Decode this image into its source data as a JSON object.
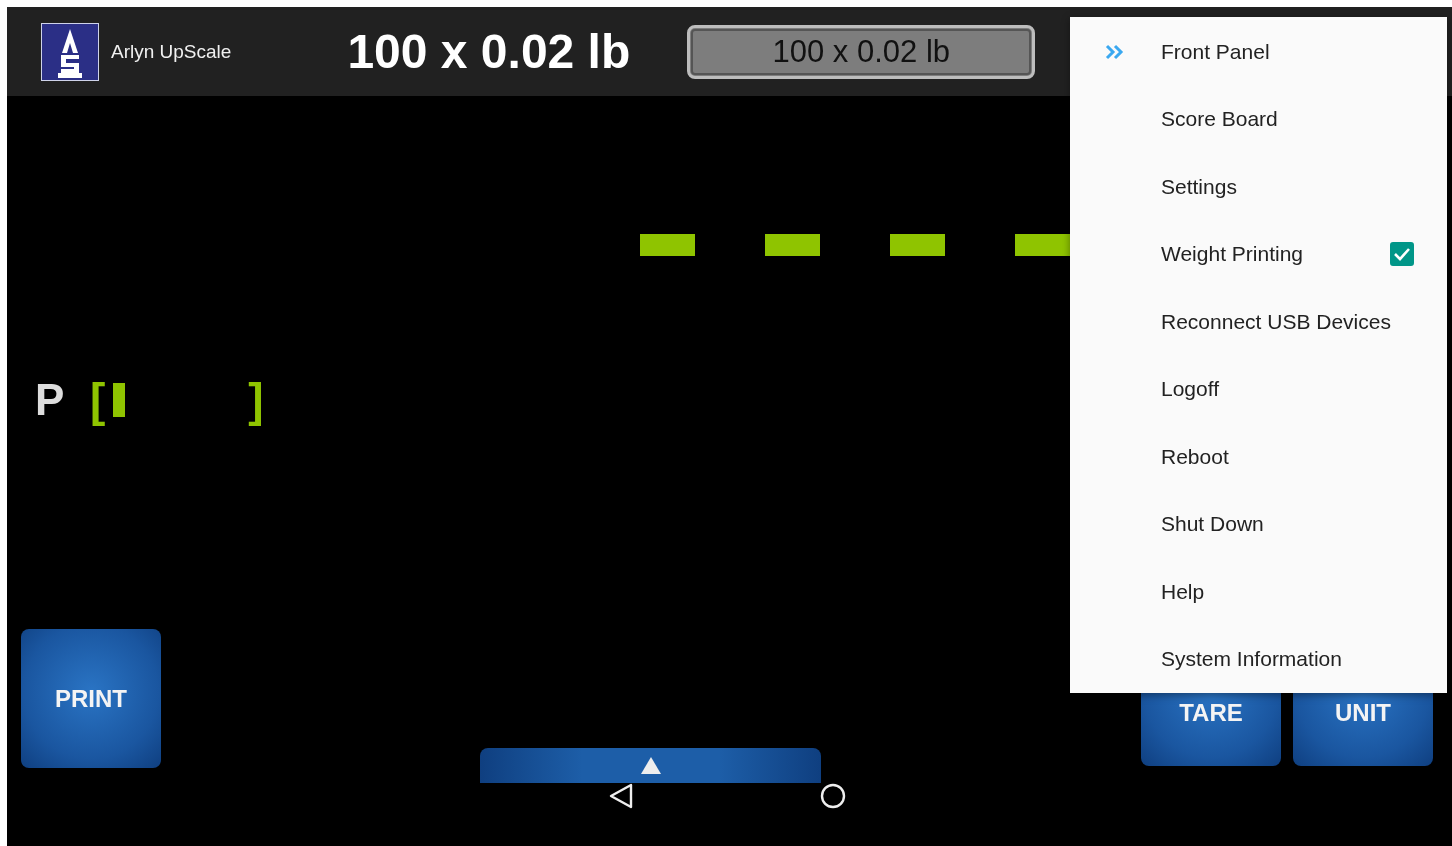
{
  "header": {
    "app_name": "Arlyn UpScale",
    "title": "100 x 0.02 lb",
    "field": {
      "value": "100 x 0.02 lb"
    }
  },
  "capacity": {
    "label": "P",
    "open_bracket": "[",
    "close_bracket": "]",
    "level": 0.09
  },
  "buttons": [
    {
      "label": "PRINT"
    },
    {
      "label": "TARE"
    },
    {
      "label": "UNIT"
    }
  ],
  "menu": {
    "items": [
      {
        "label": "Front Panel",
        "kind": "item",
        "selected": true
      },
      {
        "label": "Score Board",
        "kind": "item",
        "selected": false
      },
      {
        "label": "Settings",
        "kind": "item",
        "selected": false
      },
      {
        "label": "Weight Printing",
        "kind": "checkbox",
        "selected": false,
        "checked": true
      },
      {
        "label": "Reconnect USB Devices",
        "kind": "item",
        "selected": false
      },
      {
        "label": "Logoff",
        "kind": "item",
        "selected": false
      },
      {
        "label": "Reboot",
        "kind": "item",
        "selected": false
      },
      {
        "label": "Shut Down",
        "kind": "item",
        "selected": false
      },
      {
        "label": "Help",
        "kind": "item",
        "selected": false
      },
      {
        "label": "System Information",
        "kind": "item",
        "selected": false
      }
    ]
  }
}
